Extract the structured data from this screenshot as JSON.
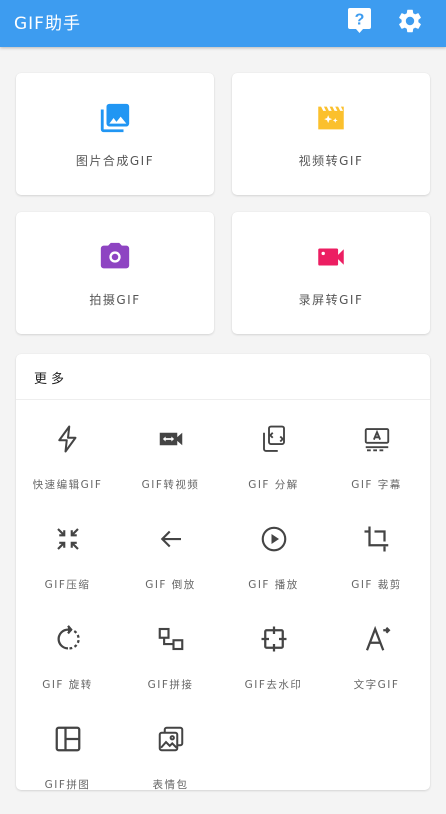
{
  "app": {
    "title": "GIF助手"
  },
  "top_cards": [
    {
      "label": "图片合成GIF",
      "icon": "photo-library-icon",
      "color": "#2196f3"
    },
    {
      "label": "视频转GIF",
      "icon": "movie-sparkle-icon",
      "color": "#fbc02d"
    },
    {
      "label": "拍摄GIF",
      "icon": "camera-icon",
      "color": "#8e44c2"
    },
    {
      "label": "录屏转GIF",
      "icon": "videocam-icon",
      "color": "#ec1e62"
    }
  ],
  "more": {
    "title": "更多",
    "tools": [
      {
        "label": "快速编辑GIF",
        "icon": "flash-icon"
      },
      {
        "label": "GIF转视频",
        "icon": "video-convert-icon"
      },
      {
        "label": "GIF 分解",
        "icon": "split-icon"
      },
      {
        "label": "GIF 字幕",
        "icon": "subtitle-icon"
      },
      {
        "label": "GIF压缩",
        "icon": "compress-icon"
      },
      {
        "label": "GIF 倒放",
        "icon": "arrow-back-icon"
      },
      {
        "label": "GIF 播放",
        "icon": "play-circle-icon"
      },
      {
        "label": "GIF 裁剪",
        "icon": "crop-icon"
      },
      {
        "label": "GIF 旋转",
        "icon": "rotate-icon"
      },
      {
        "label": "GIF拼接",
        "icon": "join-icon"
      },
      {
        "label": "GIF去水印",
        "icon": "watermark-remove-icon"
      },
      {
        "label": "文字GIF",
        "icon": "text-icon"
      },
      {
        "label": "GIF拼图",
        "icon": "collage-icon"
      },
      {
        "label": "表情包",
        "icon": "sticker-icon"
      }
    ]
  },
  "colors": {
    "appbar": "#3d9cf0",
    "icon_gray": "#444444"
  }
}
